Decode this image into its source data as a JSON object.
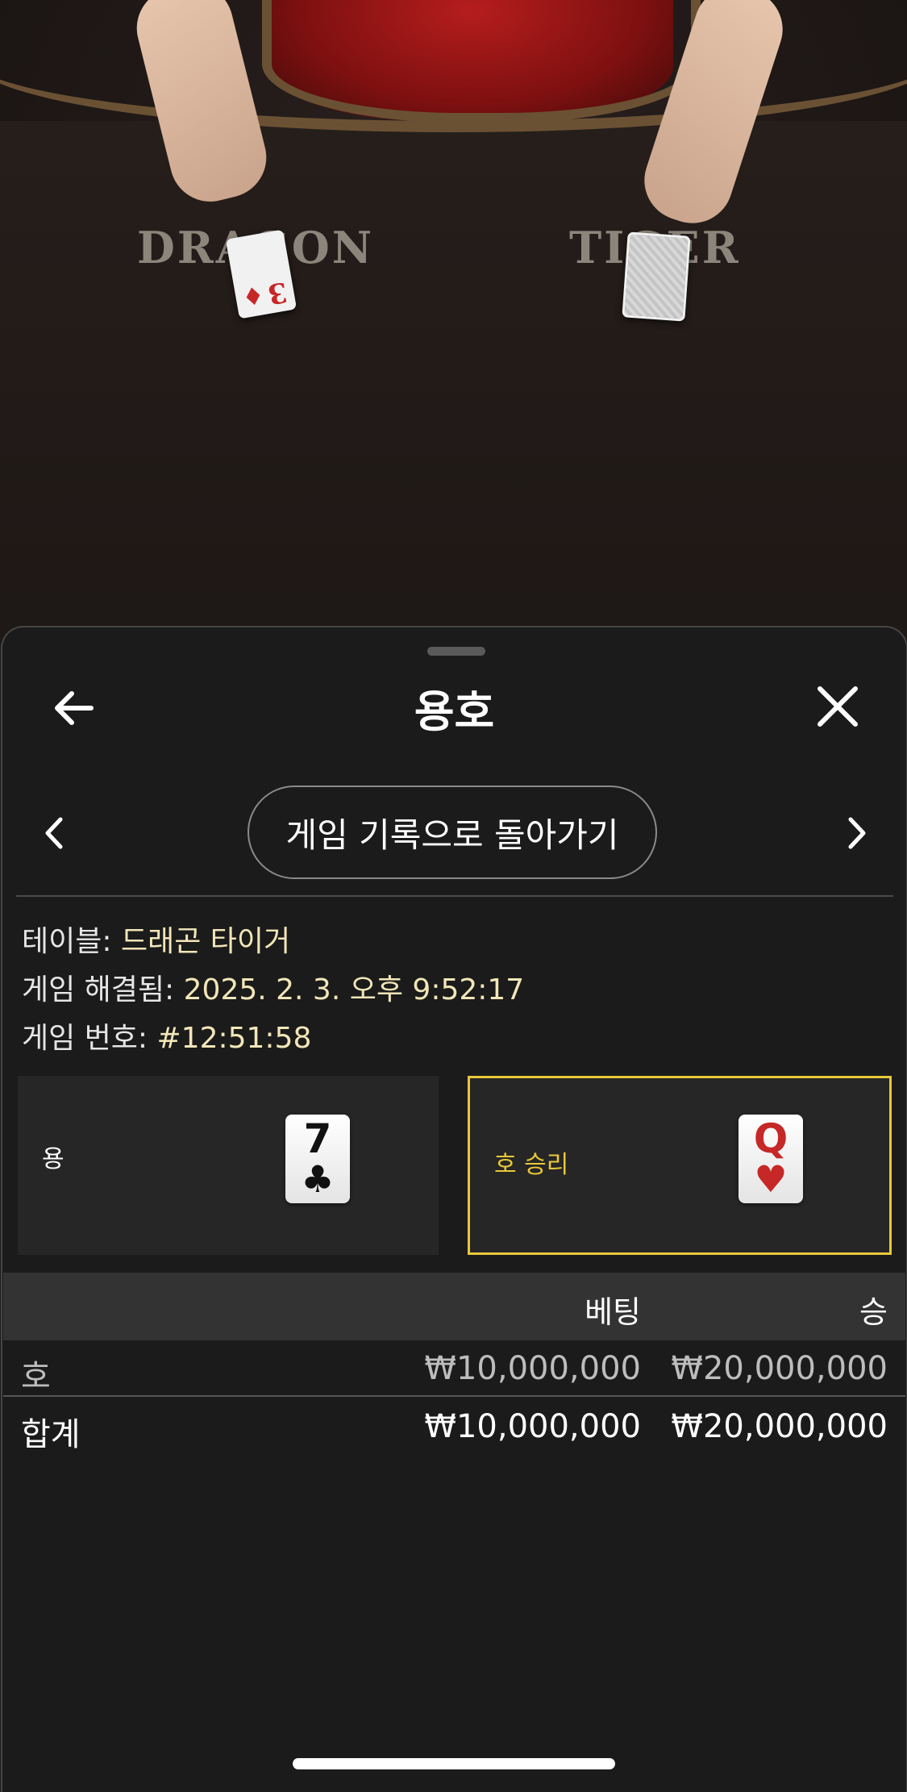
{
  "video": {
    "felt_dragon": "DRAGON",
    "felt_tiger": "TIGER",
    "dealt_card_rank": "3",
    "dealt_card_suit": "♦"
  },
  "sheet": {
    "title": "용호",
    "history_button": "게임 기록으로 돌아가기",
    "info": {
      "table_label": "테이블:",
      "table_value": "드래곤 타이거",
      "resolved_label": "게임 해결됨:",
      "resolved_value": "2025. 2. 3. 오후 9:52:17",
      "game_no_label": "게임 번호:",
      "game_no_value": "#12:51:58"
    },
    "hands": {
      "dragon": {
        "label": "용",
        "card_rank": "7",
        "card_suit": "♣"
      },
      "tiger": {
        "label": "호 승리",
        "card_rank": "Q",
        "card_suit": "♥"
      }
    },
    "table": {
      "headers": [
        "베팅",
        "승"
      ],
      "rows": [
        {
          "name": "호",
          "bet": "₩10,000,000",
          "win": "₩20,000,000"
        }
      ],
      "total": {
        "name": "합계",
        "bet": "₩10,000,000",
        "win": "₩20,000,000"
      }
    }
  },
  "colors": {
    "accent_gold": "#e8c83a",
    "card_red": "#c62828",
    "sheet_bg": "#1b1b1b"
  },
  "icons": {
    "back": "arrow-left-icon",
    "close": "close-icon",
    "prev": "chevron-left-icon",
    "next": "chevron-right-icon"
  }
}
